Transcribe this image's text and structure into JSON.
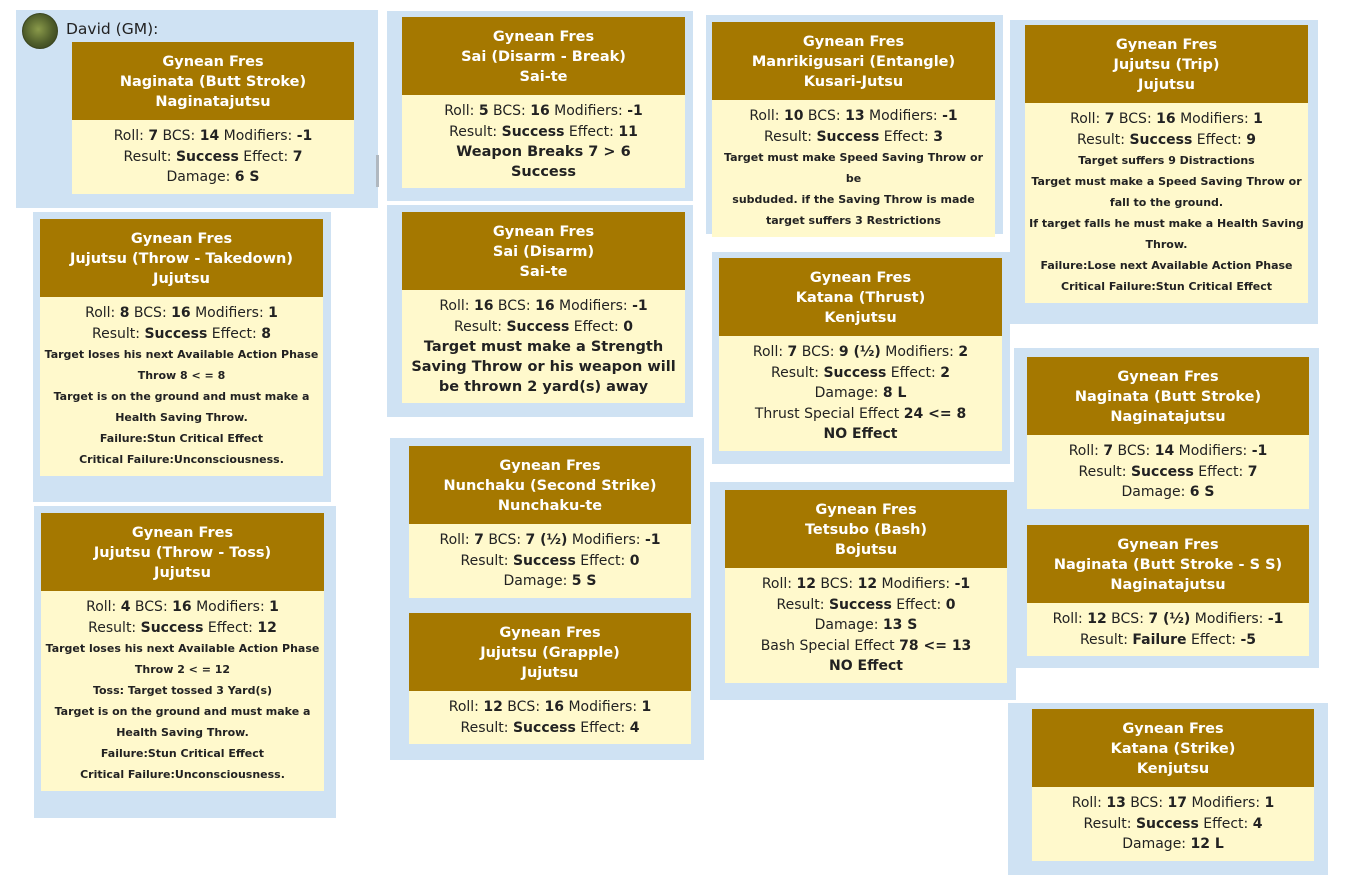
{
  "chat": {
    "speaker": "David (GM):"
  },
  "labels": {
    "roll": "Roll:",
    "bcs": "BCS:",
    "mod": "Modifiers:",
    "result": "Result:",
    "effect": "Effect:",
    "damage": "Damage:"
  },
  "cards": [
    {
      "id": "c1",
      "name": "Gynean Fres",
      "weapon": "Naginata (Butt Stroke)",
      "art": "Naginatajutsu",
      "roll": "7",
      "bcs": "14",
      "mod": "-1",
      "result": "Success",
      "effect": "7",
      "damage": "6 S"
    },
    {
      "id": "c2",
      "name": "Gynean Fres",
      "weapon": "Jujutsu (Throw - Takedown)",
      "art": "Jujutsu",
      "roll": "8",
      "bcs": "16",
      "mod": "1",
      "result": "Success",
      "effect": "8",
      "notes": [
        "Target loses his next Available Action Phase",
        "Throw  8  < =  8",
        "Target is on the ground and must make a",
        "Health Saving Throw.",
        "Failure:Stun Critical Effect",
        "Critical Failure:Unconsciousness."
      ]
    },
    {
      "id": "c3",
      "name": "Gynean Fres",
      "weapon": "Jujutsu (Throw - Toss)",
      "art": "Jujutsu",
      "roll": "4",
      "bcs": "16",
      "mod": "1",
      "result": "Success",
      "effect": "12",
      "notes": [
        "Target loses his next Available Action Phase",
        "Throw  2  < =  12",
        "Toss: Target tossed  3  Yard(s)",
        "Target is on the ground and must make a",
        "Health Saving Throw.",
        "Failure:Stun Critical Effect",
        "Critical Failure:Unconsciousness."
      ]
    },
    {
      "id": "c4",
      "name": "Gynean Fres",
      "weapon": "Sai (Disarm - Break)",
      "art": "Sai-te",
      "roll": "5",
      "bcs": "16",
      "mod": "-1",
      "result": "Success",
      "effect": "11",
      "extra": [
        "Weapon Breaks  7  >  6",
        "Success"
      ]
    },
    {
      "id": "c5",
      "name": "Gynean Fres",
      "weapon": "Sai (Disarm)",
      "art": "Sai-te",
      "roll": "16",
      "bcs": "16",
      "mod": "-1",
      "result": "Success",
      "effect": "0",
      "extra": [
        "Target must make a Strength",
        "Saving Throw or his weapon will",
        "be thrown  2  yard(s) away"
      ]
    },
    {
      "id": "c6",
      "name": "Gynean Fres",
      "weapon": "Nunchaku (Second Strike)",
      "art": "Nunchaku-te",
      "roll": "7",
      "bcs": "7 (½)",
      "mod": "-1",
      "result": "Success",
      "effect": "0",
      "damage": "5 S"
    },
    {
      "id": "c7",
      "name": "Gynean Fres",
      "weapon": "Jujutsu (Grapple)",
      "art": "Jujutsu",
      "roll": "12",
      "bcs": "16",
      "mod": "1",
      "result": "Success",
      "effect": "4"
    },
    {
      "id": "c8",
      "name": "Gynean Fres",
      "weapon": "Manrikigusari (Entangle)",
      "art": "Kusari-Jutsu",
      "roll": "10",
      "bcs": "13",
      "mod": "-1",
      "result": "Success",
      "effect": "3",
      "notes": [
        "Target must make Speed Saving Throw or be",
        "subduded. if the Saving Throw is made",
        "target suffers  3  Restrictions"
      ]
    },
    {
      "id": "c9",
      "name": "Gynean Fres",
      "weapon": "Katana (Thrust)",
      "art": "Kenjutsu",
      "roll": "7",
      "bcs": "9 (½)",
      "mod": "2",
      "result": "Success",
      "effect": "2",
      "damage": "8 L",
      "special": "Thrust Special Effect",
      "special_val": "24 <= 8",
      "special_res": "NO Effect"
    },
    {
      "id": "c10",
      "name": "Gynean Fres",
      "weapon": "Tetsubo (Bash)",
      "art": "Bojutsu",
      "roll": "12",
      "bcs": "12",
      "mod": "-1",
      "result": "Success",
      "effect": "0",
      "damage": "13 S",
      "special": "Bash Special Effect",
      "special_val": "78 <= 13",
      "special_res": "NO Effect"
    },
    {
      "id": "c11",
      "name": "Gynean Fres",
      "weapon": "Jujutsu (Trip)",
      "art": "Jujutsu",
      "roll": "7",
      "bcs": "16",
      "mod": "1",
      "result": "Success",
      "effect": "9",
      "notes": [
        "Target suffers 9 Distractions",
        "Target must make a Speed Saving Throw or",
        "fall to the ground.",
        "If target falls he must make a Health Saving",
        "Throw.",
        "Failure:Lose next Available Action Phase",
        "Critical Failure:Stun Critical Effect"
      ]
    },
    {
      "id": "c12",
      "name": "Gynean Fres",
      "weapon": "Naginata (Butt Stroke)",
      "art": "Naginatajutsu",
      "roll": "7",
      "bcs": "14",
      "mod": "-1",
      "result": "Success",
      "effect": "7",
      "damage": "6 S"
    },
    {
      "id": "c13",
      "name": "Gynean Fres",
      "weapon": "Naginata (Butt Stroke - S S)",
      "art": "Naginatajutsu",
      "roll": "12",
      "bcs": "7 (½)",
      "mod": "-1",
      "result": "Failure",
      "effect": "-5"
    },
    {
      "id": "c14",
      "name": "Gynean Fres",
      "weapon": "Katana (Strike)",
      "art": "Kenjutsu",
      "roll": "13",
      "bcs": "17",
      "mod": "1",
      "result": "Success",
      "effect": "4",
      "damage": "12 L"
    }
  ]
}
